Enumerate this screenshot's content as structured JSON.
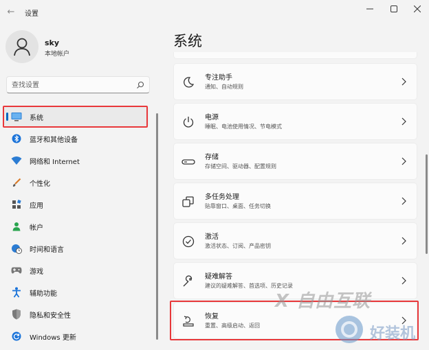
{
  "window": {
    "title": "设置",
    "back_glyph": "←",
    "minimize_glyph": "—",
    "close_glyph": "✕"
  },
  "profile": {
    "name": "sky",
    "account_type": "本地帐户"
  },
  "search": {
    "placeholder": "查找设置"
  },
  "sidebar": {
    "items": [
      {
        "label": "系统",
        "icon": "monitor-icon",
        "active": true
      },
      {
        "label": "蓝牙和其他设备",
        "icon": "bluetooth-icon"
      },
      {
        "label": "网络和 Internet",
        "icon": "wifi-icon"
      },
      {
        "label": "个性化",
        "icon": "brush-icon"
      },
      {
        "label": "应用",
        "icon": "apps-icon"
      },
      {
        "label": "帐户",
        "icon": "person-icon"
      },
      {
        "label": "时间和语言",
        "icon": "globe-clock-icon"
      },
      {
        "label": "游戏",
        "icon": "gamepad-icon"
      },
      {
        "label": "辅助功能",
        "icon": "accessibility-icon"
      },
      {
        "label": "隐私和安全性",
        "icon": "shield-icon"
      },
      {
        "label": "Windows 更新",
        "icon": "update-icon"
      }
    ]
  },
  "main": {
    "title": "系统",
    "cards": [
      {
        "title": "专注助手",
        "subtitle": "通知、自动规则",
        "icon": "moon-icon"
      },
      {
        "title": "电源",
        "subtitle": "睡眠、电池使用情况、节电模式",
        "icon": "power-icon"
      },
      {
        "title": "存储",
        "subtitle": "存储空间、驱动器、配置规则",
        "icon": "storage-icon"
      },
      {
        "title": "多任务处理",
        "subtitle": "贴靠窗口、桌面、任务切换",
        "icon": "multitask-icon"
      },
      {
        "title": "激活",
        "subtitle": "激活状态、订阅、产品密钥",
        "icon": "check-circle-icon"
      },
      {
        "title": "疑难解答",
        "subtitle": "建议的疑难解答、首选项、历史记录",
        "icon": "wrench-icon"
      },
      {
        "title": "恢复",
        "subtitle": "重置、高级启动、返回",
        "icon": "recovery-icon"
      }
    ]
  },
  "watermark": {
    "brand": "X 自由互联",
    "brand2": "好装机"
  },
  "colors": {
    "accent": "#0067c0",
    "highlight": "#e8373a"
  }
}
